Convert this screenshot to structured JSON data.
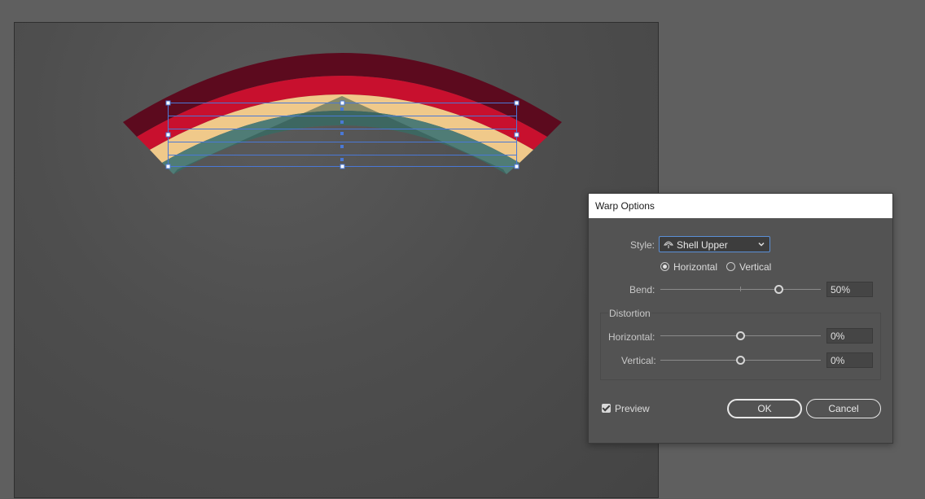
{
  "dialog": {
    "title": "Warp Options",
    "style_label": "Style:",
    "style_value": "Shell Upper",
    "orientation": {
      "horizontal_label": "Horizontal",
      "vertical_label": "Vertical",
      "selected": "Horizontal"
    },
    "bend": {
      "label": "Bend:",
      "value": "50%",
      "level": 0.5
    },
    "distortion": {
      "group_label": "Distortion",
      "horizontal": {
        "label": "Horizontal:",
        "value": "0%",
        "level": 0
      },
      "vertical": {
        "label": "Vertical:",
        "value": "0%",
        "level": 0
      }
    },
    "preview": {
      "label": "Preview",
      "checked": true
    },
    "ok_label": "OK",
    "cancel_label": "Cancel"
  },
  "canvas": {
    "rainbow_colors": [
      "#5c0a1e",
      "#c8102e",
      "#f0c98a",
      "#4f7c76",
      "#2f5550"
    ]
  },
  "colors": {
    "workspace": "#5f5f5f",
    "dialog_bg": "#535353",
    "selection": "#4a78d6"
  }
}
